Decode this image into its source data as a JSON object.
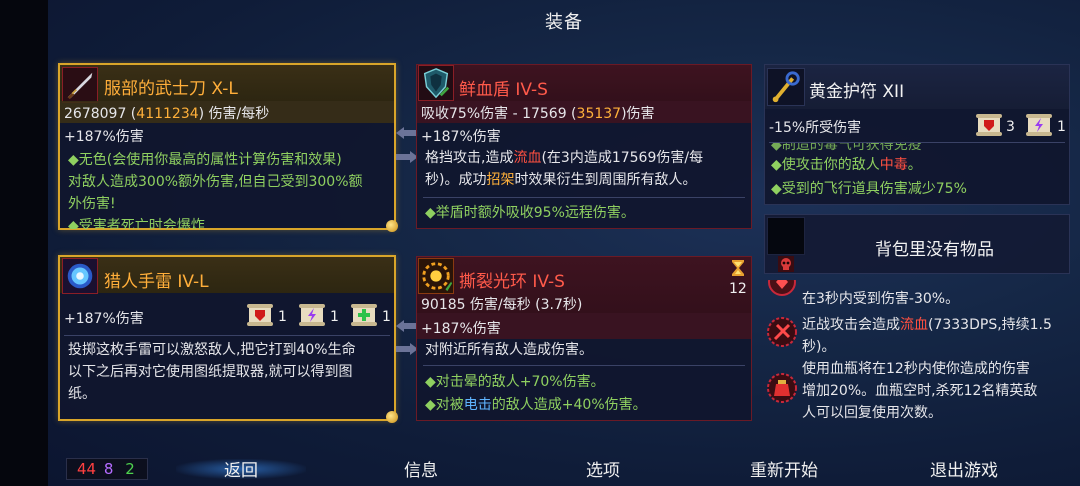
{
  "header": {
    "title": "装备"
  },
  "weapon": {
    "name": "服部的武士刀 X-L",
    "dps_value": "2678097",
    "dps_bonus": "4111234",
    "dps_unit": "伤害/每秒",
    "bonus_line": "+187%伤害",
    "desc_1": "◆无色(会使用你最高的属性计算伤害和效果)",
    "desc_2": "对敌人造成300%额外伤害,但自己受到300%额",
    "desc_3": "外伤害!",
    "desc_4": "◆受害者死亡时会爆炸"
  },
  "shield": {
    "name": "鲜血盾 IV-S",
    "stat_prefix": "吸收75%伤害 - 17569 (",
    "stat_bonus": "35137",
    "stat_suffix": ")伤害",
    "bonus_line": "+187%伤害",
    "desc_a1": "格挡攻击,造成",
    "desc_a_bleed": "流血",
    "desc_a2": "(在3内造成17569伤害/每",
    "desc_b1": "秒)。成功",
    "desc_b_parry": "招架",
    "desc_b2": "时效果衍生到周围所有敌人。",
    "desc_c": "◆举盾时额外吸收95%远程伤害。"
  },
  "amulet": {
    "name": "黄金护符 XII",
    "stat": "-15%所受伤害",
    "scroll_red_count": "3",
    "scroll_purple_count": "1",
    "line_cut": "◆制造的毒气可获得免疫",
    "line_1a": "◆使攻击你的敌人",
    "line_1b": "中毒",
    "line_1c": "。",
    "line_2": "◆受到的飞行道具伤害减少75%"
  },
  "grenade": {
    "name": "猎人手雷 IV-L",
    "bonus_line": "+187%伤害",
    "scroll_red_count": "1",
    "scroll_purple_count": "1",
    "scroll_green_count": "1",
    "desc_1": "投掷这枚手雷可以激怒敌人,把它打到40%生命",
    "desc_2": "以下之后再对它使用图纸提取器,就可以得到图",
    "desc_3": "纸。"
  },
  "aura": {
    "name": "撕裂光环 IV-S",
    "cooldown": "12",
    "stat_line": "90185 伤害/每秒 (3.7秒)",
    "bonus_line": "+187%伤害",
    "desc_1": "对附近所有敌人造成伤害。",
    "desc_2": "◆对击晕的敌人+70%伤害。",
    "desc_3a": "◆对被",
    "desc_3b": "电击",
    "desc_3c": "的敌人造成+40%伤害。"
  },
  "backpack": {
    "empty_text": "背包里没有物品"
  },
  "mutations": {
    "m1": "在3秒内受到伤害-30%。",
    "m2a": "近战攻击会造成",
    "m2b": "流血",
    "m2c": "(7333DPS,持续1.5",
    "m2d": "秒)。",
    "m3a": "使用血瓶将在12秒内使你造成的伤害",
    "m3b": "增加20%。血瓶空时,杀死12名精英敌",
    "m3c": "人可以回复使用次数。"
  },
  "stats": {
    "brutality": "44",
    "tactics": "8",
    "survival": "2"
  },
  "bottom": {
    "back": "返回",
    "info": "信息",
    "options": "选项",
    "restart": "重新开始",
    "quit": "退出游戏"
  },
  "colors": {
    "brutality": "#ff4040",
    "tactics": "#b46cff",
    "survival": "#4ed24e"
  }
}
